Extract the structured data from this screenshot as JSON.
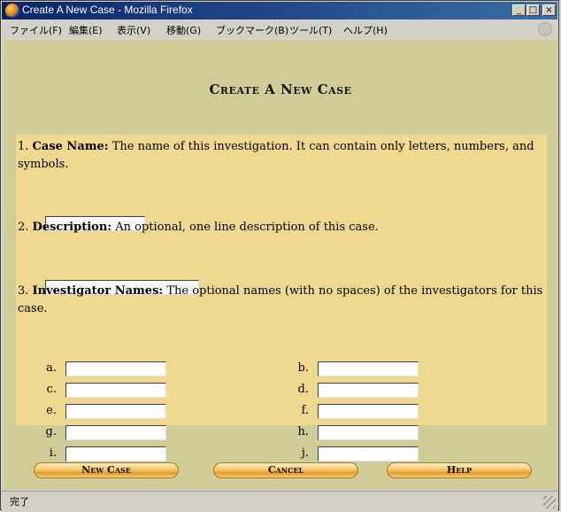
{
  "window": {
    "title": "Create A New Case - Mozilla Firefox",
    "minimize_glyph": "_",
    "maximize_glyph": "□",
    "close_glyph": "×"
  },
  "menu": [
    {
      "label": "ファイル(F)"
    },
    {
      "label": "編集(E)"
    },
    {
      "label": "表示(V)"
    },
    {
      "label": "移動(G)"
    },
    {
      "label": "ブックマーク(B)"
    },
    {
      "label": "ツール(T)"
    },
    {
      "label": "ヘルプ(H)"
    }
  ],
  "page": {
    "heading": "Create A New Case",
    "case_name": {
      "number": "1.",
      "label": "Case Name:",
      "description": "The name of this investigation. It can contain only letters, numbers, and symbols.",
      "value": ""
    },
    "description_field": {
      "number": "2.",
      "label": "Description:",
      "description": "An optional, one line description of this case.",
      "value": ""
    },
    "investigators": {
      "number": "3.",
      "label": "Investigator Names:",
      "description": "The optional names (with no spaces) of the investigators for this case.",
      "fields": [
        {
          "label": "a.",
          "value": ""
        },
        {
          "label": "b.",
          "value": ""
        },
        {
          "label": "c.",
          "value": ""
        },
        {
          "label": "d.",
          "value": ""
        },
        {
          "label": "e.",
          "value": ""
        },
        {
          "label": "f.",
          "value": ""
        },
        {
          "label": "g.",
          "value": ""
        },
        {
          "label": "h.",
          "value": ""
        },
        {
          "label": "i.",
          "value": ""
        },
        {
          "label": "j.",
          "value": ""
        }
      ]
    },
    "buttons": {
      "new_case": "New Case",
      "cancel": "Cancel",
      "help": "Help"
    }
  },
  "status": {
    "text": "完了"
  }
}
